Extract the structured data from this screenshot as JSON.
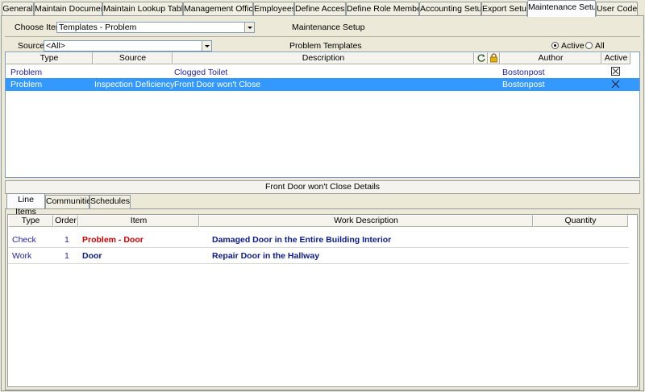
{
  "tabs": [
    {
      "label": "General"
    },
    {
      "label": "Maintain Documents"
    },
    {
      "label": "Maintain Lookup Tables"
    },
    {
      "label": "Management Offices"
    },
    {
      "label": "Employees"
    },
    {
      "label": "Define Access"
    },
    {
      "label": "Define Role Members"
    },
    {
      "label": "Accounting Setup"
    },
    {
      "label": "Export Setup"
    },
    {
      "label": "Maintenance Setup"
    },
    {
      "label": "User Codes"
    }
  ],
  "choose": {
    "label": "Choose Item:",
    "value": "Templates - Problem",
    "section_title": "Maintenance Setup"
  },
  "source": {
    "label": "Source:",
    "value": "<All>"
  },
  "templates": {
    "title": "Problem Templates",
    "active_label": "Active",
    "all_label": "All",
    "columns": {
      "type": "Type",
      "source": "Source",
      "description": "Description",
      "author": "Author",
      "active": "Active"
    },
    "rows": [
      {
        "type": "Problem",
        "source": "",
        "description": "Clogged Toilet",
        "author": "Bostonpost"
      },
      {
        "type": "Problem",
        "source": "Inspection Deficiency",
        "description": "Front Door won't Close",
        "author": "Bostonpost"
      }
    ]
  },
  "details": {
    "title": "Front Door won't Close Details"
  },
  "subtabs": [
    {
      "label": "Line Items"
    },
    {
      "label": "Communities"
    },
    {
      "label": "Schedules"
    }
  ],
  "line_items": {
    "columns": {
      "type": "Type",
      "order": "Order",
      "item": "Item",
      "work": "Work Description",
      "quantity": "Quantity"
    },
    "rows": [
      {
        "type": "Check",
        "order": "1",
        "item": "Problem - Door",
        "work": "Damaged Door in the Entire Building Interior"
      },
      {
        "type": "Work",
        "order": "1",
        "item": "Door",
        "work": "Repair Door in the Hallway"
      }
    ]
  },
  "colors": {
    "selection": "#3399ff",
    "link_blue": "#1f1fa8",
    "bold_blue": "#0a1a8c",
    "problem_red": "#d40000"
  }
}
